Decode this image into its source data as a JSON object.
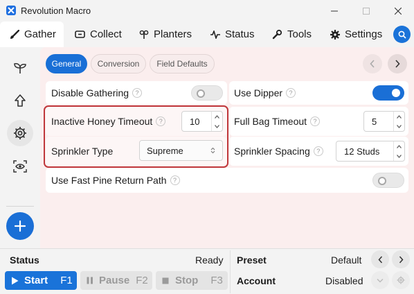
{
  "window": {
    "title": "Revolution Macro"
  },
  "nav": {
    "tabs": [
      {
        "label": "Gather",
        "icon": "brush-icon"
      },
      {
        "label": "Collect",
        "icon": "collect-icon"
      },
      {
        "label": "Planters",
        "icon": "planter-icon"
      },
      {
        "label": "Status",
        "icon": "pulse-icon"
      },
      {
        "label": "Tools",
        "icon": "wrench-icon"
      },
      {
        "label": "Settings",
        "icon": "gear-icon"
      }
    ],
    "active": "Gather"
  },
  "subtabs": [
    {
      "label": "General",
      "active": true
    },
    {
      "label": "Conversion",
      "active": false
    },
    {
      "label": "Field Defaults",
      "active": false
    }
  ],
  "settings": {
    "disable_gathering": {
      "label": "Disable Gathering",
      "help": "?",
      "enabled": false
    },
    "use_dipper": {
      "label": "Use Dipper",
      "help": "?",
      "enabled": true
    },
    "inactive_honey_timeout": {
      "label": "Inactive Honey Timeout",
      "help": "?",
      "value": "10"
    },
    "full_bag_timeout": {
      "label": "Full Bag Timeout",
      "help": "?",
      "value": "5"
    },
    "sprinkler_type": {
      "label": "Sprinkler Type",
      "value": "Supreme"
    },
    "sprinkler_spacing": {
      "label": "Sprinkler Spacing",
      "help": "?",
      "value": "12 Studs"
    },
    "use_fast_pine_return": {
      "label": "Use Fast Pine Return Path",
      "help": "?",
      "enabled": false
    }
  },
  "status_bar": {
    "status_label": "Status",
    "status_value": "Ready",
    "preset_label": "Preset",
    "preset_value": "Default",
    "account_label": "Account",
    "account_value": "Disabled",
    "start": {
      "label": "Start",
      "key": "F1"
    },
    "pause": {
      "label": "Pause",
      "key": "F2"
    },
    "stop": {
      "label": "Stop",
      "key": "F3"
    }
  },
  "colors": {
    "accent": "#1a6fd6",
    "highlight_border": "#c0373b",
    "panel_bg": "#fbeeee"
  }
}
